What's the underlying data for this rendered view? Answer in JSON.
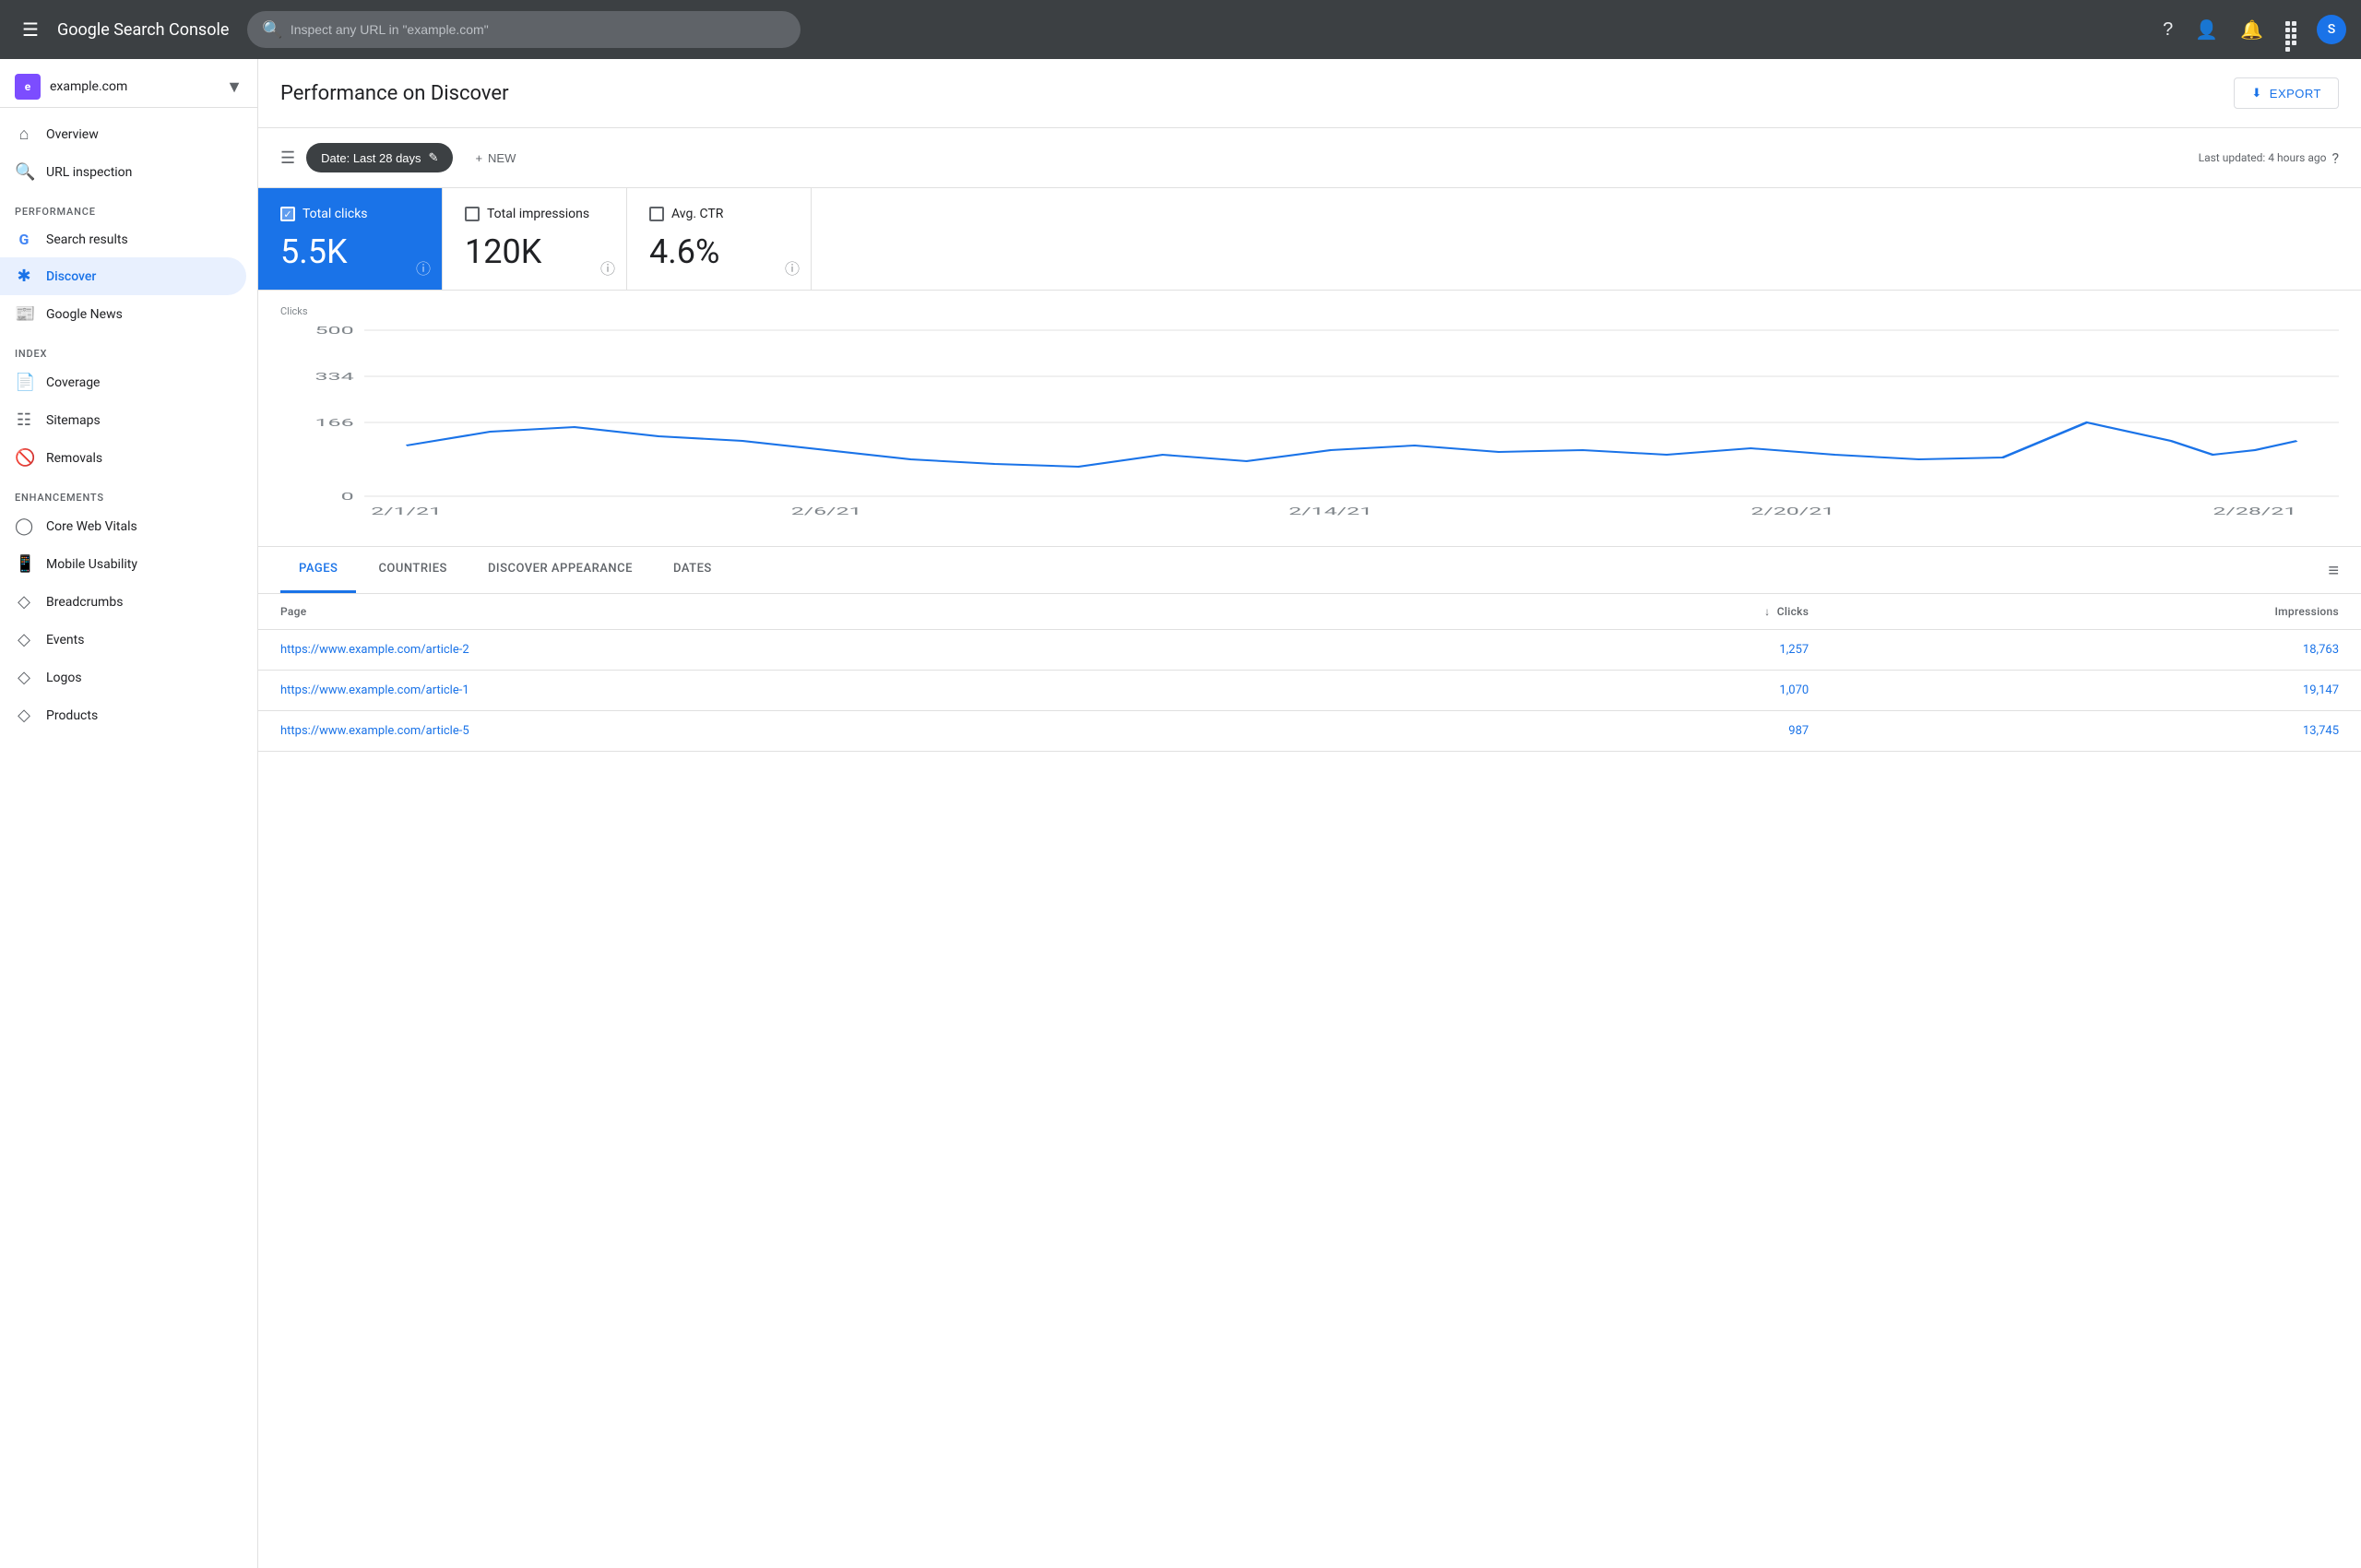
{
  "app": {
    "name": "Google Search Console",
    "name_part1": "Google",
    "name_part2": "Search Console"
  },
  "topnav": {
    "search_placeholder": "Inspect any URL in \"example.com\"",
    "avatar_letter": "S"
  },
  "property": {
    "name": "example.com",
    "icon_letter": "e"
  },
  "sidebar": {
    "overview_label": "Overview",
    "url_inspection_label": "URL inspection",
    "sections": [
      {
        "label": "Performance",
        "items": [
          {
            "id": "search-results",
            "label": "Search results"
          },
          {
            "id": "discover",
            "label": "Discover",
            "active": true
          },
          {
            "id": "google-news",
            "label": "Google News"
          }
        ]
      },
      {
        "label": "Index",
        "items": [
          {
            "id": "coverage",
            "label": "Coverage"
          },
          {
            "id": "sitemaps",
            "label": "Sitemaps"
          },
          {
            "id": "removals",
            "label": "Removals"
          }
        ]
      },
      {
        "label": "Enhancements",
        "items": [
          {
            "id": "core-web-vitals",
            "label": "Core Web Vitals"
          },
          {
            "id": "mobile-usability",
            "label": "Mobile Usability"
          },
          {
            "id": "breadcrumbs",
            "label": "Breadcrumbs"
          },
          {
            "id": "events",
            "label": "Events"
          },
          {
            "id": "logos",
            "label": "Logos"
          },
          {
            "id": "products",
            "label": "Products"
          }
        ]
      }
    ]
  },
  "page": {
    "title": "Performance on Discover",
    "export_label": "EXPORT"
  },
  "filter_bar": {
    "date_label": "Date: Last 28 days",
    "new_label": "NEW",
    "last_updated": "Last updated: 4 hours ago"
  },
  "metrics": [
    {
      "id": "total-clicks",
      "label": "Total clicks",
      "value": "5.5K",
      "active": true
    },
    {
      "id": "total-impressions",
      "label": "Total impressions",
      "value": "120K",
      "active": false
    },
    {
      "id": "avg-ctr",
      "label": "Avg. CTR",
      "value": "4.6%",
      "active": false
    }
  ],
  "chart": {
    "y_label": "Clicks",
    "y_ticks": [
      "500",
      "334",
      "166",
      "0"
    ],
    "x_ticks": [
      "2/1/21",
      "2/6/21",
      "2/14/21",
      "2/20/21",
      "2/28/21"
    ],
    "color": "#1a73e8"
  },
  "table": {
    "tabs": [
      {
        "id": "pages",
        "label": "PAGES",
        "active": true
      },
      {
        "id": "countries",
        "label": "COUNTRIES",
        "active": false
      },
      {
        "id": "discover-appearance",
        "label": "DISCOVER APPEARANCE",
        "active": false
      },
      {
        "id": "dates",
        "label": "DATES",
        "active": false
      }
    ],
    "columns": [
      {
        "id": "page",
        "label": "Page",
        "align": "left"
      },
      {
        "id": "clicks",
        "label": "Clicks",
        "align": "right",
        "sort": true
      },
      {
        "id": "impressions",
        "label": "Impressions",
        "align": "right"
      }
    ],
    "rows": [
      {
        "page": "https://www.example.com/article-2",
        "clicks": "1,257",
        "impressions": "18,763"
      },
      {
        "page": "https://www.example.com/article-1",
        "clicks": "1,070",
        "impressions": "19,147"
      },
      {
        "page": "https://www.example.com/article-5",
        "clicks": "987",
        "impressions": "13,745"
      }
    ]
  }
}
